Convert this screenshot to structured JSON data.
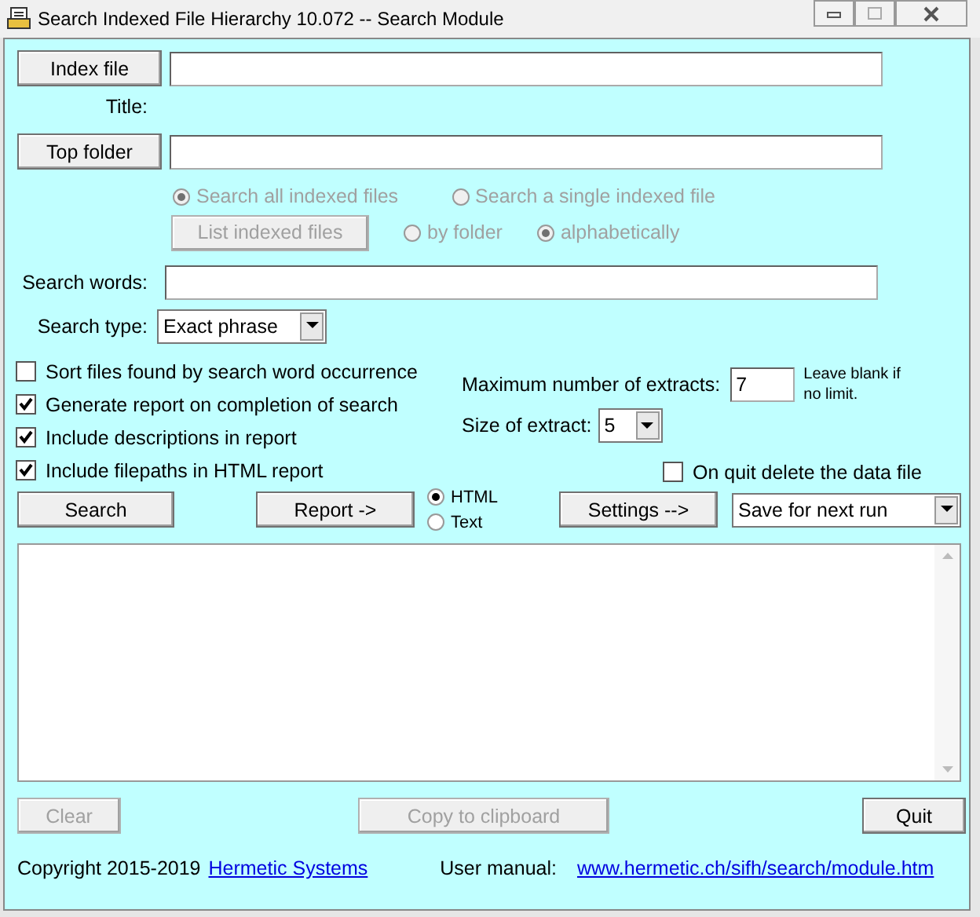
{
  "window": {
    "title": "Search Indexed File Hierarchy 10.072 -- Search Module"
  },
  "index_file": {
    "button": "Index file"
  },
  "title_label": "Title:",
  "top_folder": {
    "button": "Top folder"
  },
  "scope_radios": [
    {
      "label": "Search all indexed files",
      "selected": true,
      "disabled": true
    },
    {
      "label": "Search a single indexed file",
      "selected": false,
      "disabled": true
    }
  ],
  "list_button": {
    "label": "List indexed files",
    "disabled": true
  },
  "order_radios": [
    {
      "label": "by folder",
      "selected": false,
      "disabled": true
    },
    {
      "label": "alphabetically",
      "selected": true,
      "disabled": true
    }
  ],
  "search_words": {
    "label": "Search words:"
  },
  "search_type": {
    "label": "Search type:",
    "value": "Exact phrase"
  },
  "options": [
    {
      "label": "Sort files found by search word occurrence",
      "checked": false
    },
    {
      "label": "Generate report on completion of search",
      "checked": true
    },
    {
      "label": "Include descriptions in report",
      "checked": true
    },
    {
      "label": "Include filepaths in HTML report",
      "checked": true
    }
  ],
  "max_extracts": {
    "label": "Maximum number of extracts:",
    "value": "7",
    "note": "Leave blank if no limit."
  },
  "extract_size": {
    "label": "Size of extract:",
    "value": "5"
  },
  "quit_delete": {
    "label": "On quit delete the data file",
    "checked": false
  },
  "search_button": {
    "label": "Search",
    "disabled": false
  },
  "report_button": {
    "label": "Report ->",
    "disabled": false
  },
  "format_radios": [
    {
      "label": "HTML",
      "selected": true,
      "disabled": false
    },
    {
      "label": "Text",
      "selected": false,
      "disabled": false
    }
  ],
  "settings_button": {
    "label": "Settings -->",
    "disabled": false
  },
  "settings_select": {
    "value": "Save for next run"
  },
  "clear_button": {
    "label": "Clear",
    "disabled": true
  },
  "copy_button": {
    "label": "Copy to clipboard",
    "disabled": true
  },
  "quit_button": {
    "label": "Quit",
    "disabled": false
  },
  "footer": {
    "copyright": "Copyright 2015-2019",
    "company_link": "Hermetic Systems",
    "manual_label": "User manual:",
    "manual_link": "www.hermetic.ch/sifh/search/module.htm"
  }
}
